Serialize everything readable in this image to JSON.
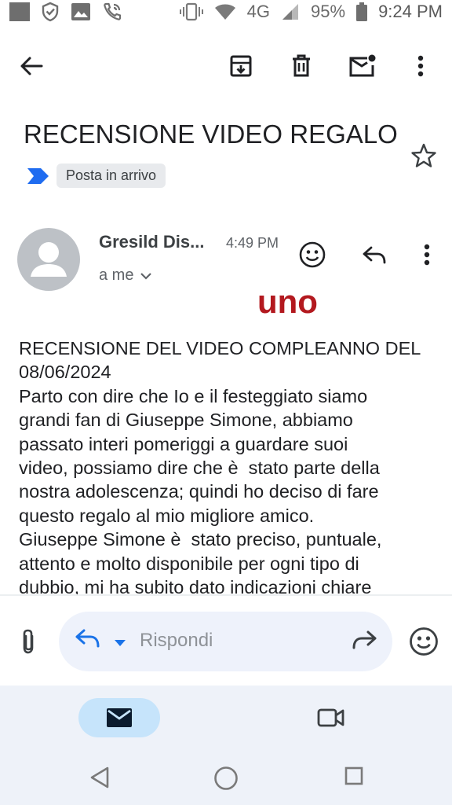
{
  "status_bar": {
    "network": "4G",
    "battery": "95%",
    "time": "9:24 PM"
  },
  "toolbar": {
    "back_icon": "arrow-left-icon",
    "archive_icon": "archive-icon",
    "delete_icon": "trash-icon",
    "mark_unread_icon": "mail-unread-icon",
    "more_icon": "more-vert-icon"
  },
  "email": {
    "subject": "RECENSIONE VIDEO REGALO",
    "label": "Posta in arrivo",
    "sender_name": "Gresild Dis...",
    "time": "4:49 PM",
    "recipient": "a me",
    "overlay_word": "uno",
    "body": "RECENSIONE DEL VIDEO COMPLEANNO DEL\n08/06/2024\nParto con dire che Io e il festeggiato siamo\ngrandi fan di Giuseppe Simone, abbiamo\npassato interi pomeriggi a guardare suoi\nvideo, possiamo dire che è  stato parte della\nnostra adolescenza; quindi ho deciso di fare\nquesto regalo al mio migliore amico.\nGiuseppe Simone è  stato preciso, puntuale,\nattento e molto disponibile per ogni tipo di\ndubbio, mi ha subito dato indicazioni chiare"
  },
  "reply_bar": {
    "placeholder": "Rispondi"
  },
  "colors": {
    "accent_blue": "#1a73e8",
    "label_arrow": "#1f6cf0",
    "overlay_red": "#b3191f",
    "nav_active": "#c6e4fb"
  }
}
